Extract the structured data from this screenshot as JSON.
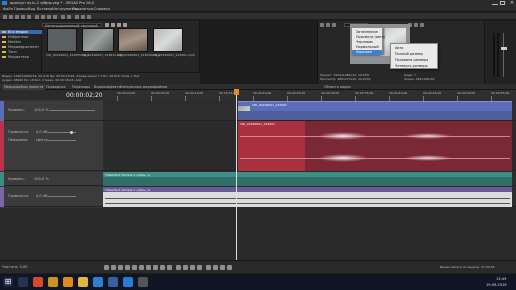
{
  "window": {
    "title": "аранчун путь 2 зубры.veg * - VEGAS Pro 16.0"
  },
  "menu": [
    "Файл",
    "Правка",
    "Вид",
    "Вставка",
    "Инструменты",
    "Параметры",
    "Справка"
  ],
  "explorer": {
    "path": "Интегрированный звуковой",
    "tree_items": [
      "Вся медиа",
      "Избранное",
      "Medien",
      "Медиафрагмент",
      "Теги",
      "Медиатека"
    ],
    "thumbs": [
      "VID_20190601_124955.mp4",
      "VID_20190601_124812.mp4",
      "VID_20190601_124549.mp4",
      "VID_20190601_125001.mp4"
    ],
    "info": "Видео: 1920x1080x32, 29.970 fps, 00:00:18;25, Альфа-канал = Нет, 29.970, Поле = Нет",
    "info2": "Аудио: 48000 Hz, 16 бит, Стерео, 00:00:18;24, AAC"
  },
  "tabs": [
    "Медиафайлы проекта",
    "Проводник",
    "Переходы",
    "Видеоэффекты",
    "Генераторы медиафайлов",
    "Область видео"
  ],
  "preview": {
    "project": "Проект: 1920x1080x32, 29.970i",
    "preview_res": "Просмотр: 480x270x32, 29.970p",
    "frame": "Кадр: 7",
    "display": "Экран: 349x196x32"
  },
  "context_menu": {
    "items": [
      "Затемнение",
      "Просмотр (авто)",
      "Черновик",
      "Нормальный",
      "Хорошее",
      "Лучшее"
    ],
    "selected": "Хорошее",
    "submenu": [
      "Авто",
      "Полный размер",
      "Половина размера",
      "Четверть размера"
    ],
    "submenu_selected": "Авто"
  },
  "timeline": {
    "timecode": "00:00:02;20",
    "ruler_labels": [
      "00:00:00;00",
      "00:00:05;00",
      "00:00:10;00",
      "00:00:15;00",
      "00:00:20;00",
      "00:00:25;00",
      "00:00:30;00",
      "00:00:35;00",
      "00:00:40;00",
      "00:00:45;00",
      "00:00:50;00",
      "00:00:55;00"
    ],
    "tracks": [
      {
        "name": "Уровень:",
        "value": "100,0 %",
        "kind": "video"
      },
      {
        "name": "Громкость:",
        "value": "0,0 dB",
        "kind": "audio"
      },
      {
        "name": "Панорама:",
        "value": "Центр",
        "kind": "audio"
      },
      {
        "name": "Уровень:",
        "value": "100,0 %",
        "kind": "text"
      },
      {
        "name": "Громкость:",
        "value": "0,0 dB",
        "kind": "audio2"
      }
    ],
    "clip_labels": [
      "VID_20190601_125001",
      "VID_20190601_125001",
      "Titles/Text (Simple 1 зубры_1)",
      "Titles/Text (Simple 1 зубры_1)"
    ],
    "rate": "Частота: 0,00",
    "status_time": "Время записи (2 канала): 57:09:05"
  },
  "taskbar": {
    "clock": "13:49",
    "date": "19.09.2019"
  },
  "colors": {
    "video_track": "#5b6db8",
    "audio_track": "#b8344a",
    "text_track": "#3d8f86",
    "cursor": "#dddddd"
  }
}
